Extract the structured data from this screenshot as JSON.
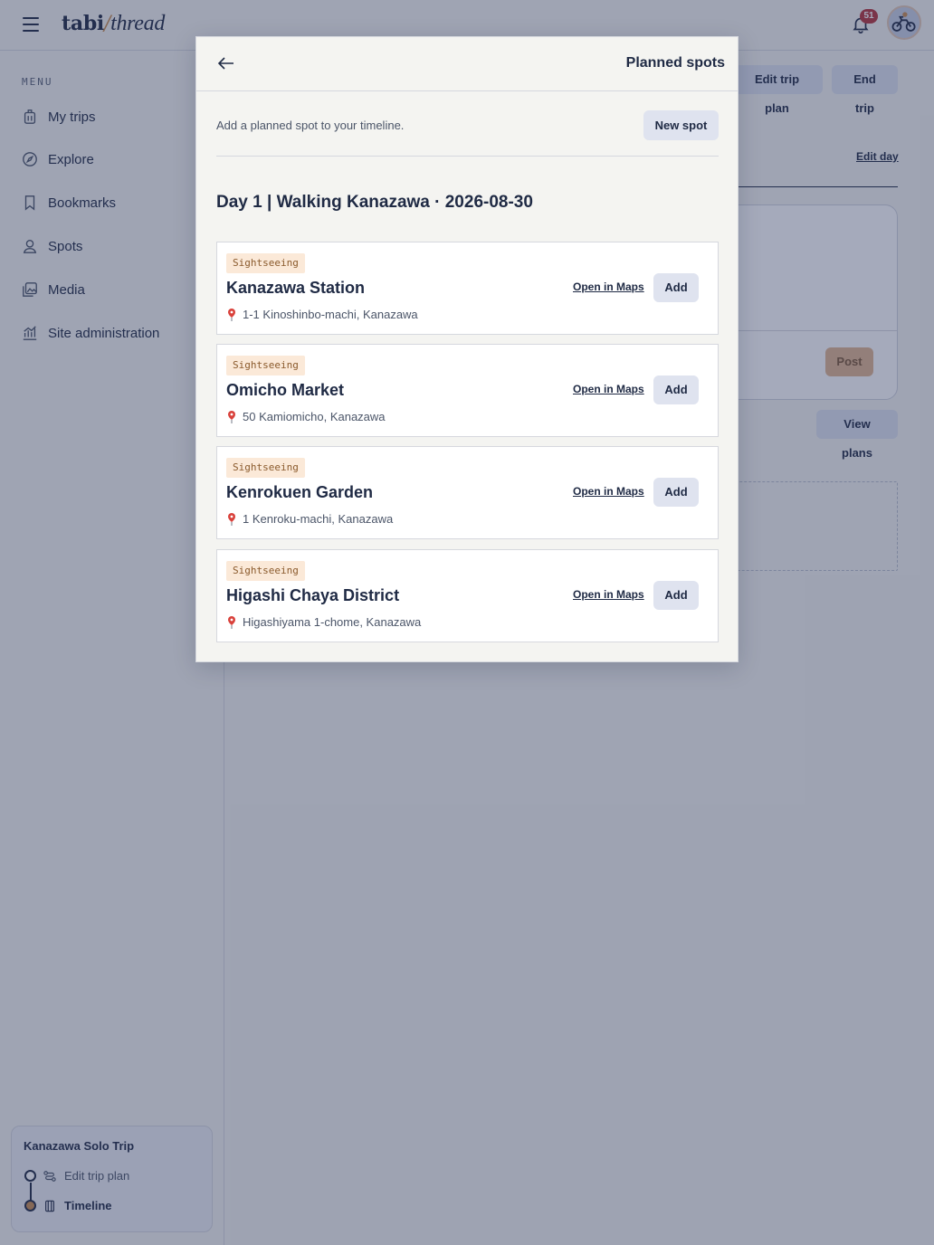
{
  "app": {
    "logo_bold": "tabi",
    "logo_slash": "/",
    "logo_italic": "thread",
    "notification_count": "51"
  },
  "sidebar": {
    "menu_label": "MENU",
    "items": [
      {
        "label": "My trips",
        "icon": "luggage-icon"
      },
      {
        "label": "Explore",
        "icon": "compass-icon"
      },
      {
        "label": "Bookmarks",
        "icon": "bookmark-icon"
      },
      {
        "label": "Spots",
        "icon": "user-pin-icon"
      },
      {
        "label": "Media",
        "icon": "image-icon"
      },
      {
        "label": "Site administration",
        "icon": "chart-icon"
      }
    ],
    "trip": {
      "title": "Kanazawa Solo Trip",
      "steps": [
        {
          "label": "Edit trip plan",
          "active": false
        },
        {
          "label": "Timeline",
          "active": true
        }
      ]
    }
  },
  "main": {
    "edit_trip_plan": "Edit trip plan",
    "end_trip": "End trip",
    "edit_day": "Edit day",
    "post": "Post",
    "view_plans": "View plans"
  },
  "modal": {
    "title": "Planned spots",
    "hint": "Add a planned spot to your timeline.",
    "new_spot": "New spot",
    "day_title": "Day 1 | Walking Kanazawa · 2026-08-30",
    "open_in_maps": "Open in Maps",
    "add": "Add",
    "spots": [
      {
        "tag": "Sightseeing",
        "name": "Kanazawa Station",
        "address": "1-1 Kinoshinbo-machi, Kanazawa"
      },
      {
        "tag": "Sightseeing",
        "name": "Omicho Market",
        "address": "50 Kamiomicho, Kanazawa"
      },
      {
        "tag": "Sightseeing",
        "name": "Kenrokuen Garden",
        "address": "1 Kenroku-machi, Kanazawa"
      },
      {
        "tag": "Sightseeing",
        "name": "Higashi Chaya District",
        "address": "Higashiyama 1-chome, Kanazawa"
      }
    ]
  },
  "colors": {
    "ink": "#1f2a44",
    "accent": "#c98d52",
    "tag_bg": "#fbe9d8",
    "overlay": "#28345c"
  }
}
